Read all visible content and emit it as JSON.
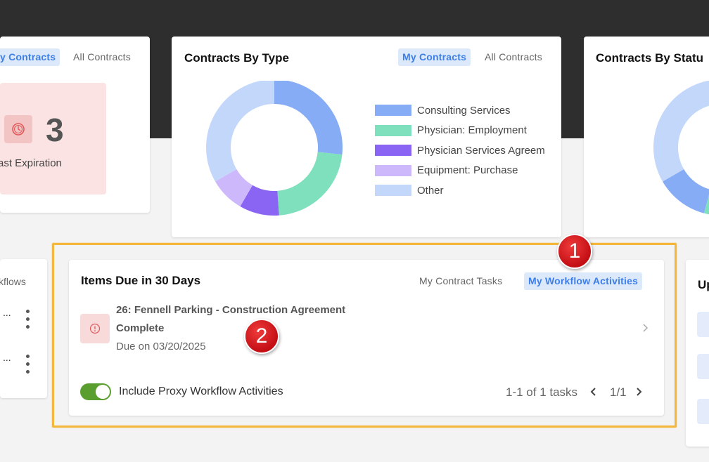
{
  "left_card": {
    "tab_my": "y Contracts",
    "tab_all": "All Contracts",
    "tile_count": "3",
    "tile_label": "Past Expiration",
    "tile_label_visible": "ast Expiration"
  },
  "type_card": {
    "title": "Contracts By Type",
    "tab_my": "My Contracts",
    "tab_all": "All Contracts",
    "legend": [
      {
        "label": "Consulting Services",
        "color": "#86acf6"
      },
      {
        "label": "Physician: Employment",
        "color": "#7fe0bd"
      },
      {
        "label": "Physician Services Agreem",
        "color": "#8a64f3"
      },
      {
        "label": "Equipment: Purchase",
        "color": "#cdb8fb"
      },
      {
        "label": "Other",
        "color": "#c3d7fb"
      }
    ]
  },
  "status_card": {
    "title": "Contracts By Statu"
  },
  "workflows_card": {
    "label": "kflows",
    "row1": "...",
    "row2": "..."
  },
  "due_card": {
    "title": "Items Due in 30 Days",
    "tab_tasks": "My Contract Tasks",
    "tab_workflow": "My Workflow Activities",
    "item_title": "26: Fennell Parking - Construction Agreement",
    "item_status": "Complete",
    "item_due": "Due on 03/20/2025",
    "proxy_label": "Include Proxy Workflow Activities",
    "task_range": "1-1 of 1 tasks",
    "page": "1/1"
  },
  "right_card": {
    "title_fragment": "Up"
  },
  "markers": {
    "one": "1",
    "two": "2"
  },
  "colors": {
    "accent": "#3d7ee8",
    "highlight": "#f3b73d",
    "marker": "#d11a1f",
    "toggle_on": "#5a9e2f"
  }
}
